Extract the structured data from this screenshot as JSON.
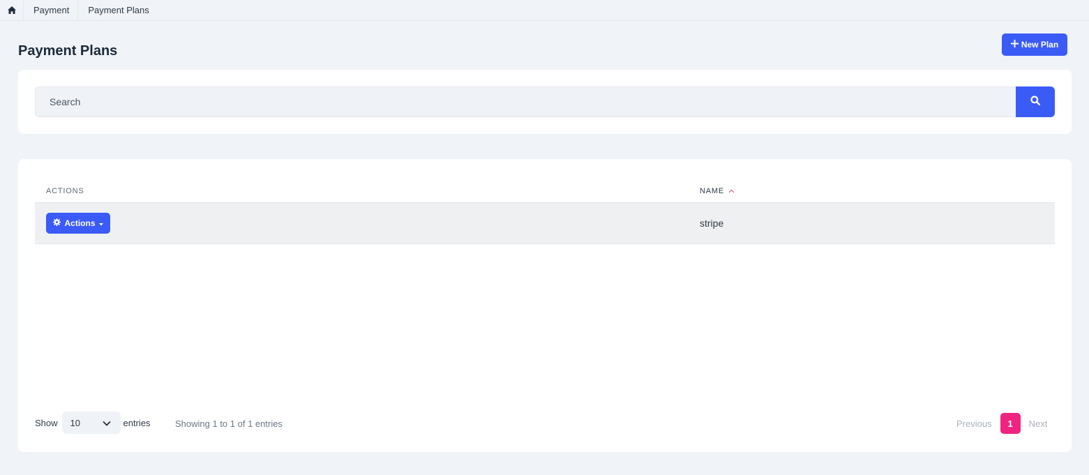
{
  "breadcrumb": {
    "home_icon": "home-icon",
    "items": [
      "Payment",
      "Payment Plans"
    ]
  },
  "header": {
    "title": "Payment Plans",
    "new_button_label": "New Plan",
    "new_button_icon": "plus-icon"
  },
  "search": {
    "placeholder": "Search",
    "value": "",
    "button_icon": "search-icon"
  },
  "table": {
    "columns": [
      "ACTIONS",
      "NAME"
    ],
    "sort": {
      "column": "NAME",
      "direction": "ascending"
    },
    "rows": [
      {
        "actions_label": "Actions",
        "name": "stripe"
      }
    ]
  },
  "footer": {
    "show_label": "Show",
    "entries_value": "10",
    "entries_label": "entries",
    "info": "Showing 1 to 1 of 1 entries",
    "pagination": {
      "previous": "Previous",
      "current_page": "1",
      "next": "Next"
    }
  },
  "colors": {
    "primary": "#3b5bf7",
    "page_active": "#f0237f",
    "background": "#f0f3f7"
  }
}
